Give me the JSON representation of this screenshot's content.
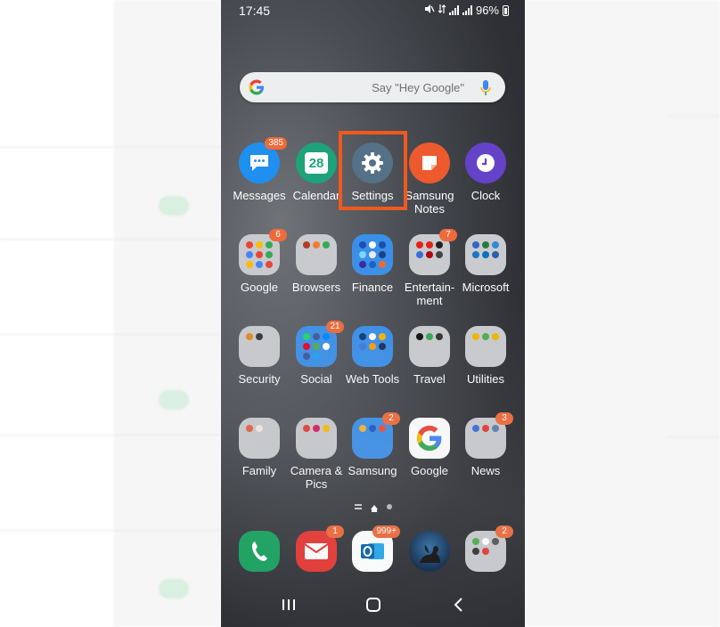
{
  "status_bar": {
    "time": "17:45",
    "battery": "96%"
  },
  "search": {
    "placeholder": "Say \"Hey Google\""
  },
  "apps": {
    "messages": {
      "label": "Messages",
      "badge": "385"
    },
    "calendar": {
      "label": "Calendar",
      "day": "28"
    },
    "settings": {
      "label": "Settings"
    },
    "samsung_notes": {
      "label": "Samsung Notes"
    },
    "clock": {
      "label": "Clock"
    },
    "google_folder": {
      "label": "Google",
      "badge": "6"
    },
    "browsers": {
      "label": "Browsers"
    },
    "finance": {
      "label": "Finance"
    },
    "entertainment": {
      "label": "Entertain-ment",
      "badge": "7"
    },
    "microsoft": {
      "label": "Microsoft"
    },
    "security": {
      "label": "Security"
    },
    "social": {
      "label": "Social",
      "badge": "21"
    },
    "web_tools": {
      "label": "Web Tools"
    },
    "travel": {
      "label": "Travel"
    },
    "utilities": {
      "label": "Utilities"
    },
    "family": {
      "label": "Family"
    },
    "camera_pics": {
      "label": "Camera & Pics"
    },
    "samsung": {
      "label": "Samsung",
      "badge": "2"
    },
    "google_app": {
      "label": "Google"
    },
    "news": {
      "label": "News",
      "badge": "3"
    }
  },
  "dock": {
    "phone": {
      "label": "Phone"
    },
    "email": {
      "label": "Email",
      "badge": "1"
    },
    "outlook": {
      "label": "Outlook",
      "badge": "999+"
    },
    "kindle": {
      "label": "Kindle"
    },
    "folder": {
      "label": "Folder",
      "badge": "2"
    }
  },
  "colors": {
    "highlight": "#f0591e",
    "badge": "#ee6a3a"
  }
}
